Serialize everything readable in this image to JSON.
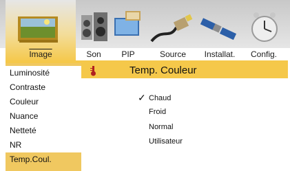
{
  "tabs": [
    {
      "label": "Image",
      "icon": "image-icon",
      "active": true
    },
    {
      "label": "Son",
      "icon": "speakers-icon",
      "active": false
    },
    {
      "label": "PIP",
      "icon": "pip-icon",
      "active": false
    },
    {
      "label": "Source",
      "icon": "cable-connector-icon",
      "active": false
    },
    {
      "label": "Installat.",
      "icon": "satellite-icon",
      "active": false
    },
    {
      "label": "Config.",
      "icon": "clock-icon",
      "active": false
    }
  ],
  "menu": {
    "items": [
      "Luminosité",
      "Contraste",
      "Couleur",
      "Nuance",
      "Netteté",
      "NR",
      "Temp.Coul."
    ],
    "selected_index": 6
  },
  "panel": {
    "title": "Temp. Couleur",
    "title_icon": "thermometer-icon",
    "options": [
      "Chaud",
      "Froid",
      "Normal",
      "Utilisateur"
    ],
    "checked_index": 0,
    "check_glyph": "✓"
  },
  "colors": {
    "accent": "#f5c84a",
    "selected_bg": "#f0c860",
    "tabbar_bg": "#d6d6d6"
  }
}
